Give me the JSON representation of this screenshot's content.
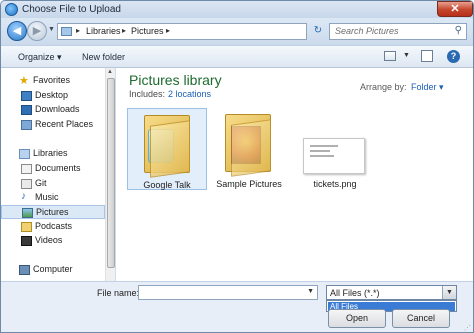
{
  "window": {
    "title": "Choose File to Upload",
    "close_label": "✕"
  },
  "address": {
    "crumbs": [
      "Libraries",
      "Pictures"
    ],
    "search_placeholder": "Search Pictures"
  },
  "toolbar": {
    "organize_label": "Organize ▾",
    "new_folder_label": "New folder"
  },
  "sidebar": {
    "favorites_label": "Favorites",
    "favorites": [
      "Desktop",
      "Downloads",
      "Recent Places"
    ],
    "libraries_label": "Libraries",
    "libraries": [
      "Documents",
      "Git",
      "Music",
      "Pictures",
      "Podcasts",
      "Videos"
    ],
    "computer_label": "Computer",
    "selected": "Pictures"
  },
  "content": {
    "library_title": "Pictures library",
    "includes_label": "Includes:",
    "locations_link": "2 locations",
    "arrange_label": "Arrange by:",
    "arrange_value": "Folder ▾",
    "items": [
      {
        "name": "Google Talk",
        "type": "folder"
      },
      {
        "name": "Sample Pictures",
        "type": "folder"
      },
      {
        "name": "tickets.png",
        "type": "png"
      }
    ]
  },
  "bottom": {
    "file_name_label": "File name:",
    "file_name_value": "",
    "filter_value": "All Files (*.*)",
    "dropdown_options": [
      "All Files"
    ],
    "open_label": "Open",
    "cancel_label": "Cancel"
  },
  "colors": {
    "accent": "#3a7bd5",
    "library_title": "#1e6b2f",
    "link": "#1c5fb5"
  }
}
